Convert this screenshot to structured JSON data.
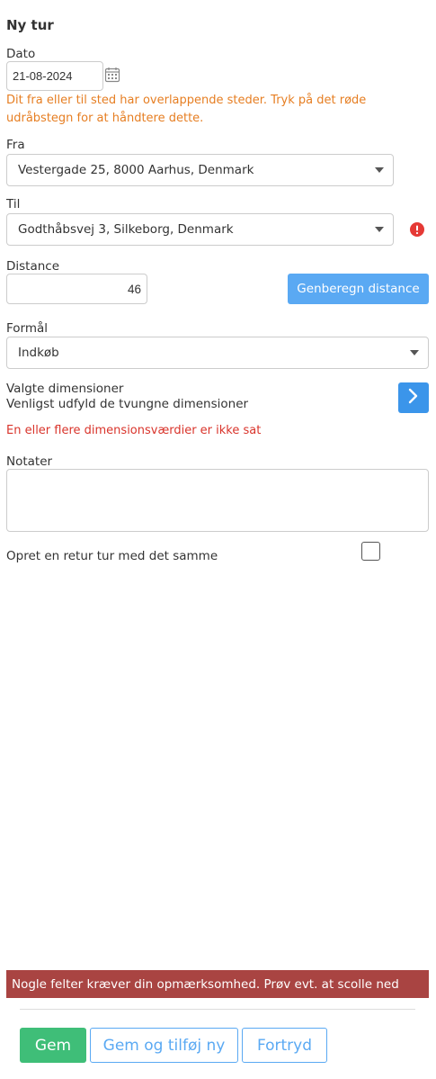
{
  "page": {
    "title": "Ny tur"
  },
  "date": {
    "label": "Dato",
    "value": "21-08-2024",
    "icon": "calendar-icon"
  },
  "warning": {
    "text": "Dit fra eller til sted har overlappende steder. Tryk på det røde udråbstegn for at håndtere dette."
  },
  "from": {
    "label": "Fra",
    "value": "Vestergade 25, 8000 Aarhus, Denmark"
  },
  "to": {
    "label": "Til",
    "value": "Godthåbsvej 3, Silkeborg, Denmark",
    "alert_icon": "exclamation-icon"
  },
  "distance": {
    "label": "Distance",
    "value": "46",
    "recalc_label": "Genberegn distance"
  },
  "purpose": {
    "label": "Formål",
    "value": "Indkøb"
  },
  "dimensions": {
    "title": "Valgte dimensioner",
    "subtitle": "Venligst udfyld de tvungne dimensioner",
    "error": "En eller flere dimensionsværdier er ikke sat",
    "nav_icon": "chevron-right-icon"
  },
  "notes": {
    "label": "Notater",
    "value": ""
  },
  "return_trip": {
    "label": "Opret en retur tur med det samme",
    "checked": false
  },
  "banner": {
    "text": "Nogle felter kræver din opmærksomhed. Prøv evt. at scolle ned"
  },
  "footer": {
    "save_label": "Gem",
    "save_add_label": "Gem og tilføj ny",
    "cancel_label": "Fortryd"
  },
  "colors": {
    "accent": "#5aa9f3",
    "warning": "#e67e22",
    "error": "#d9342b",
    "banner": "#a94442",
    "save": "#3fbe78"
  }
}
